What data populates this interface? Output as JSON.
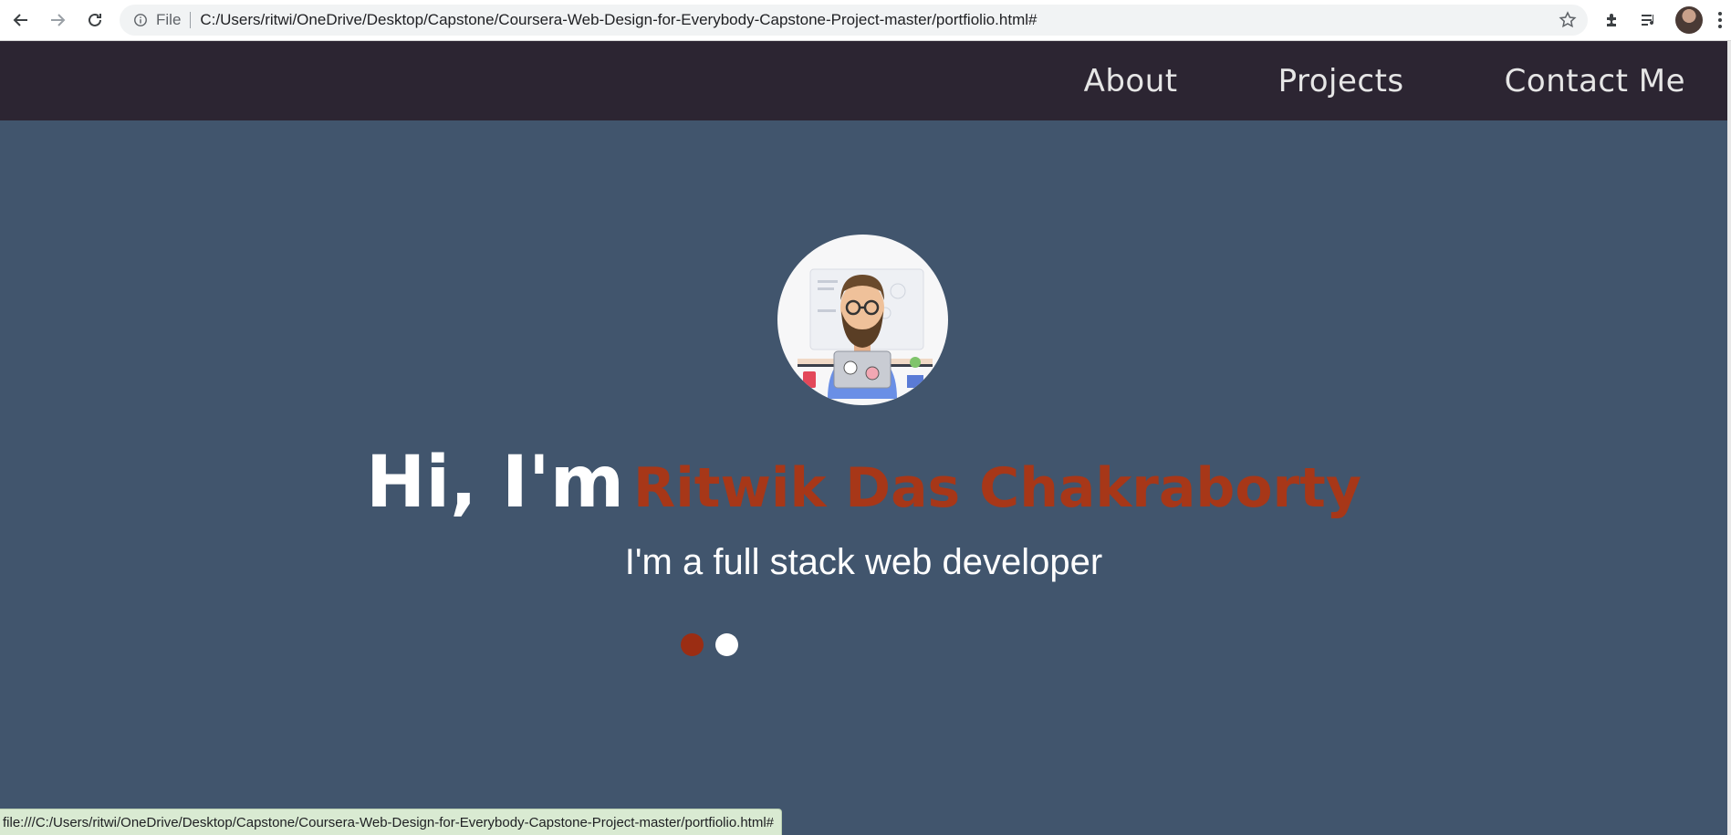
{
  "browser": {
    "omnibox": {
      "scheme_label": "File",
      "url": "C:/Users/ritwi/OneDrive/Desktop/Capstone/Coursera-Web-Design-for-Everybody-Capstone-Project-master/portfiolio.html#"
    },
    "status_url": "file:///C:/Users/ritwi/OneDrive/Desktop/Capstone/Coursera-Web-Design-for-Everybody-Capstone-Project-master/portfiolio.html#",
    "icons": [
      "back-arrow-icon",
      "forward-arrow-icon",
      "reload-icon",
      "info-icon",
      "star-icon",
      "puzzle-extension-icon",
      "reading-list-icon",
      "profile-avatar",
      "more-vert-icon"
    ]
  },
  "site": {
    "nav": [
      {
        "label": "About"
      },
      {
        "label": "Projects"
      },
      {
        "label": "Contact Me"
      }
    ],
    "hero": {
      "greeting": "Hi, I'm",
      "name": "Ritwik Das Chakraborty",
      "tagline": "I'm a full stack web developer",
      "carousel_total": 2,
      "carousel_active": 1
    },
    "colors": {
      "header_bg": "#2c2532",
      "hero_bg": "#41556d",
      "accent": "#a73718"
    }
  }
}
